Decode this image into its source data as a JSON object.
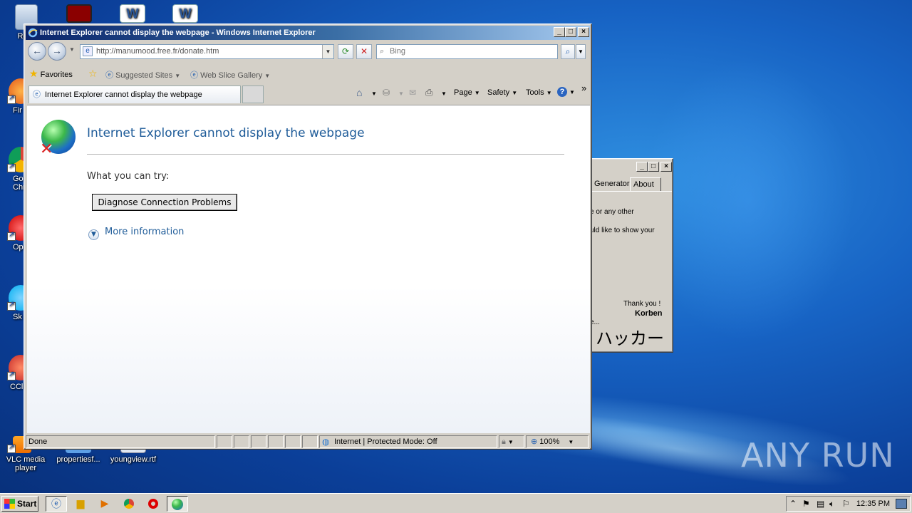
{
  "desktop": {
    "icons": [
      {
        "label": "Recy",
        "icon": "recycle-bin-icon"
      },
      {
        "label": "Fir",
        "icon": "firefox-icon"
      },
      {
        "label": "Go Chr",
        "icon": "chrome-icon"
      },
      {
        "label": "Op",
        "icon": "opera-icon"
      },
      {
        "label": "Sk",
        "icon": "skype-icon"
      },
      {
        "label": "CCl",
        "icon": "ccleaner-icon"
      },
      {
        "label": "VLC media player",
        "icon": "vlc-icon"
      },
      {
        "label": "propertiesf...",
        "icon": "file-icon"
      },
      {
        "label": "youngview.rtf",
        "icon": "rtf-file-icon"
      }
    ],
    "watermark": "ANY RUN"
  },
  "bg_window": {
    "tabs": [
      "Generator",
      "About"
    ],
    "lines": [
      "e or any other",
      "uld like to show your",
      "Thank you !",
      "Korben",
      "e...",
      "ハッカー"
    ]
  },
  "ie": {
    "title": "Internet Explorer cannot display the webpage - Windows Internet Explorer",
    "address": "http://manumood.free.fr/donate.htm",
    "search_placeholder": "Bing",
    "favorites_bar": {
      "favorites": "Favorites",
      "suggested": "Suggested Sites",
      "webslice": "Web Slice Gallery"
    },
    "tab_title": "Internet Explorer cannot display the webpage",
    "commands": {
      "page": "Page",
      "safety": "Safety",
      "tools": "Tools",
      "more": "»"
    },
    "content": {
      "heading": "Internet Explorer cannot display the webpage",
      "what_you_can_try": "What you can try:",
      "diagnose_button": "Diagnose Connection Problems",
      "more_info": "More information"
    },
    "status": {
      "text": "Done",
      "zone": "Internet | Protected Mode: Off",
      "zoom": "100%"
    }
  },
  "taskbar": {
    "start": "Start",
    "clock": "12:35 PM"
  },
  "colors": {
    "ie_link_blue": "#1f5c99",
    "title_active": "#0a246a",
    "desktop_blue": "#1763c4"
  }
}
